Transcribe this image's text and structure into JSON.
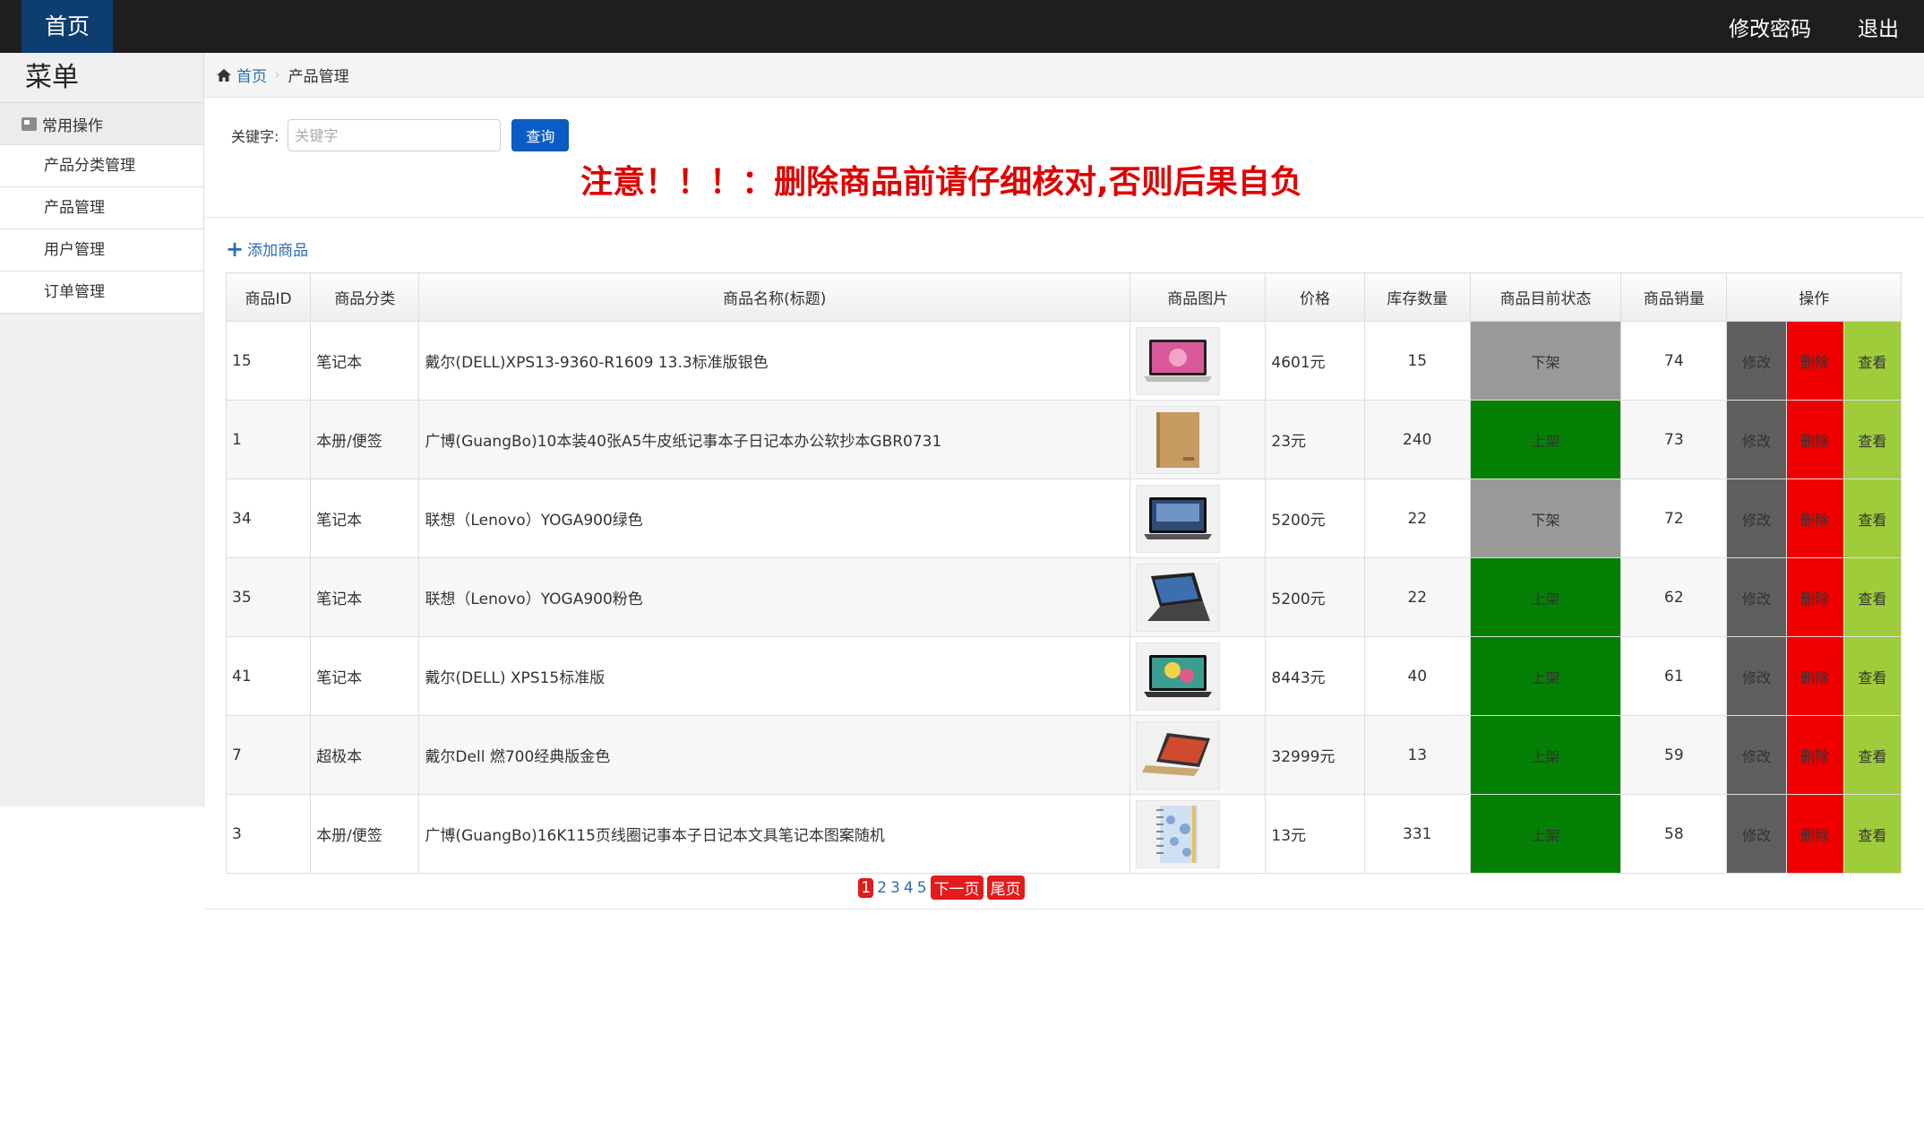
{
  "topbar": {
    "home_label": "首页",
    "change_password": "修改密码",
    "logout": "退出"
  },
  "sidebar": {
    "menu_title": "菜单",
    "group_label": "常用操作",
    "items": [
      {
        "label": "产品分类管理"
      },
      {
        "label": "产品管理"
      },
      {
        "label": "用户管理"
      },
      {
        "label": "订单管理"
      }
    ]
  },
  "breadcrumb": {
    "home": "首页",
    "current": "产品管理"
  },
  "search": {
    "label": "关键字:",
    "placeholder": "关键字",
    "value": "",
    "button": "查询"
  },
  "warning": "注意！！！：删除商品前请仔细核对,否则后果自负",
  "add_product": "添加商品",
  "table": {
    "headers": [
      "商品ID",
      "商品分类",
      "商品名称(标题)",
      "商品图片",
      "价格",
      "库存数量",
      "商品目前状态",
      "商品销量",
      "操作"
    ],
    "actions": {
      "edit": "修改",
      "delete": "删除",
      "view": "查看"
    },
    "rows": [
      {
        "id": "15",
        "category": "笔记本",
        "name": "戴尔(DELL)XPS13-9360-R1609 13.3标准版银色",
        "image": "laptop-pink-screen",
        "price": "4601元",
        "stock": "15",
        "status": "下架",
        "status_on": false,
        "sales": "74"
      },
      {
        "id": "1",
        "category": "本册/便签",
        "name": "广博(GuangBo)10本装40张A5牛皮纸记事本子日记本办公软抄本GBR0731",
        "image": "kraft-notebook",
        "price": "23元",
        "stock": "240",
        "status": "上架",
        "status_on": true,
        "sales": "73"
      },
      {
        "id": "34",
        "category": "笔记本",
        "name": "联想（Lenovo）YOGA900绿色",
        "image": "laptop-dark",
        "price": "5200元",
        "stock": "22",
        "status": "下架",
        "status_on": false,
        "sales": "72"
      },
      {
        "id": "35",
        "category": "笔记本",
        "name": "联想（Lenovo）YOGA900粉色",
        "image": "laptop-flip",
        "price": "5200元",
        "stock": "22",
        "status": "上架",
        "status_on": true,
        "sales": "62"
      },
      {
        "id": "41",
        "category": "笔记本",
        "name": "戴尔(DELL) XPS15标准版",
        "image": "laptop-colorful",
        "price": "8443元",
        "stock": "40",
        "status": "上架",
        "status_on": true,
        "sales": "61"
      },
      {
        "id": "7",
        "category": "超极本",
        "name": "戴尔Dell 燃700经典版金色",
        "image": "laptop-gold",
        "price": "32999元",
        "stock": "13",
        "status": "上架",
        "status_on": true,
        "sales": "59"
      },
      {
        "id": "3",
        "category": "本册/便签",
        "name": "广博(GuangBo)16K115页线圈记事本子日记本文具笔记本图案随机",
        "image": "spiral-notebook",
        "price": "13元",
        "stock": "331",
        "status": "上架",
        "status_on": true,
        "sales": "58"
      }
    ]
  },
  "pagination": {
    "current": "1",
    "pages": [
      "2",
      "3",
      "4",
      "5"
    ],
    "next": "下一页",
    "last": "尾页"
  },
  "colors": {
    "topbar": "#1e1e1e",
    "home_tab": "#0d3e70",
    "warning": "#e00000",
    "status_on": "#048004",
    "status_off": "#999999",
    "edit": "#5f5f5f",
    "delete": "#f00000",
    "view": "#9fcc3a"
  }
}
